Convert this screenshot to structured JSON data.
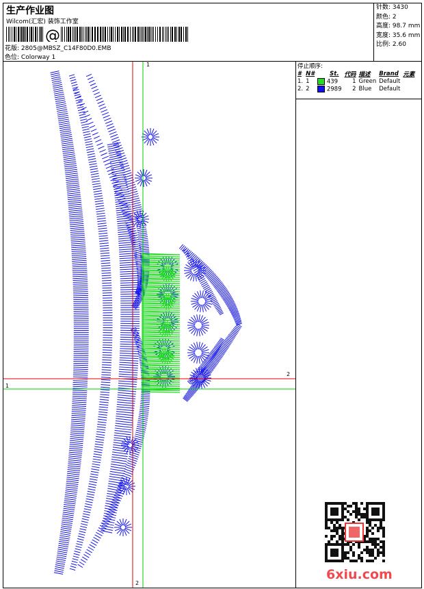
{
  "header": {
    "title": "生产作业图",
    "company": "Wilcom(汇宏) 装饰工作室",
    "barcode_symbol": "@",
    "design_label": "花版:",
    "design_value": "2805@MBSZ_C14F80D0.EMB",
    "colorway_label": "色位:",
    "colorway_value": "Colorway 1"
  },
  "stats": [
    {
      "label": "针数:",
      "value": "3430"
    },
    {
      "label": "颜色:",
      "value": "2"
    },
    {
      "label": "高度:",
      "value": "98.7 mm"
    },
    {
      "label": "宽度:",
      "value": "35.6 mm"
    },
    {
      "label": "比例:",
      "value": "2.60"
    }
  ],
  "stop_sequence": {
    "heading": "停止顺序:",
    "columns": [
      "#",
      "N#",
      "St.",
      "代码",
      "描述",
      "Brand",
      "元素"
    ],
    "rows": [
      {
        "index": "1.",
        "needle": "1",
        "color": "#22dd22",
        "stitches": "439",
        "code": "1",
        "desc": "Green",
        "brand": "Default"
      },
      {
        "index": "2.",
        "needle": "2",
        "color": "#1111ee",
        "stitches": "2989",
        "code": "2",
        "desc": "Blue",
        "brand": "Default"
      }
    ]
  },
  "axes": {
    "green_v_top": "1",
    "red_h_right": "2",
    "green_h_left": "1",
    "red_v_bottom": "2"
  },
  "colors": {
    "primary_thread": "#1111ee",
    "secondary_thread": "#22dd22",
    "axis_red": "#e00000",
    "axis_green": "#00cc00"
  },
  "qr_icon": "qr-code-icon",
  "watermark": "6xiu.com"
}
